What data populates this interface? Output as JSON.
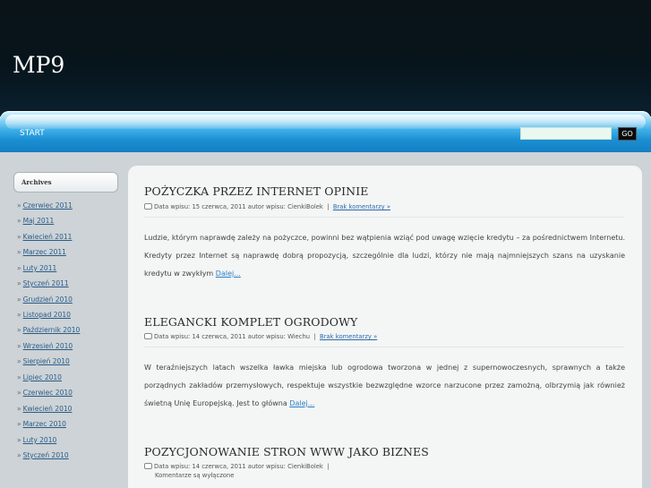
{
  "header": {
    "title": "MP9"
  },
  "nav": {
    "start": "START"
  },
  "search": {
    "placeholder": "",
    "button": "GO"
  },
  "sidebar": {
    "title": "Archives",
    "items": [
      "Czerwiec 2011",
      "Maj 2011",
      "Kwiecień 2011",
      "Marzec 2011",
      "Luty 2011",
      "Styczeń 2011",
      "Grudzień 2010",
      "Listopad 2010",
      "Październik 2010",
      "Wrzesień 2010",
      "Sierpień 2010",
      "Lipiec 2010",
      "Czerwiec 2010",
      "Kwiecień 2010",
      "Marzec 2010",
      "Luty 2010",
      "Styczeń 2010"
    ]
  },
  "posts": [
    {
      "title": "POŻYCZKA PRZEZ INTERNET OPINIE",
      "meta_text": "Data wpisu: 15 czerwca, 2011 autor wpisu: CienkiBolek",
      "comments": "Brak komentarzy »",
      "body": "Ludzie, którym naprawdę zależy na pożyczce, powinni bez wątpienia wziąć pod uwagę wzięcie kredytu – za pośrednictwem Internetu. Kredyty przez Internet są naprawdę dobrą propozycją, szczególnie dla ludzi, którzy nie mają najmniejszych szans na uzyskanie kredytu w zwykłym",
      "more": "Dalej..."
    },
    {
      "title": "ELEGANCKI KOMPLET OGRODOWY",
      "meta_text": "Data wpisu: 14 czerwca, 2011 autor wpisu: Wiechu",
      "comments": "Brak komentarzy »",
      "body": "W teraźniejszych latach wszelka ławka miejska lub ogrodowa tworzona w jednej z supernowoczesnych, sprawnych a także porządnych zakładów przemysłowych, respektuje wszystkie bezwzględne wzorce narzucone przez zamożną, olbrzymią jak również świetną Unię Europejską. Jest to główna",
      "more": "Dalej..."
    },
    {
      "title": "POZYCJONOWANIE STRON WWW JAKO BIZNES",
      "meta_text": "Data wpisu: 14 czerwca, 2011 autor wpisu: CienkiBolek",
      "comments": "Komentarze są wyłączone"
    }
  ]
}
